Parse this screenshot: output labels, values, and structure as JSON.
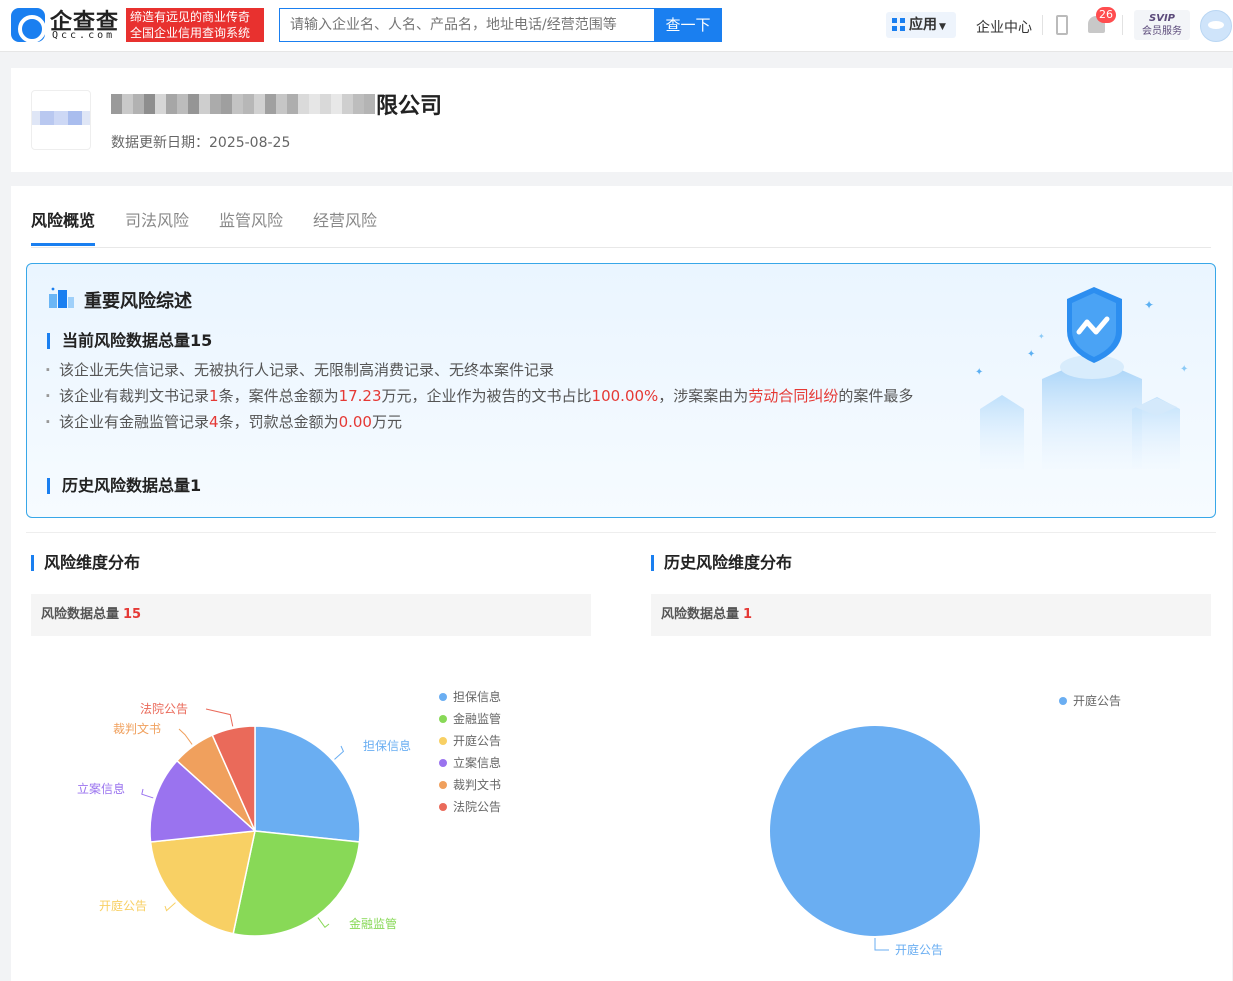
{
  "header": {
    "logo_cn": "企查查",
    "logo_en": "Qcc.com",
    "slogan_line1": "缔造有远见的商业传奇",
    "slogan_line2": "全国企业信用查询系统",
    "search_placeholder": "请输入企业名、人名、产品名，地址电话/经营范围等",
    "search_button": "查一下",
    "apps_label": "应用",
    "enterprise_center": "企业中心",
    "notification_count": "26",
    "svip_line1": "SVIP",
    "svip_line2": "会员服务"
  },
  "company": {
    "name_visible_suffix": "限公司",
    "update_date_label": "数据更新日期：",
    "update_date": "2025-08-25"
  },
  "tabs": [
    {
      "label": "风险概览",
      "active": true
    },
    {
      "label": "司法风险",
      "active": false
    },
    {
      "label": "监管风险",
      "active": false
    },
    {
      "label": "经营风险",
      "active": false
    }
  ],
  "summary": {
    "title": "重要风险综述",
    "current_heading": "当前风险数据总量15",
    "history_heading": "历史风险数据总量1",
    "line1": "该企业无失信记录、无被执行人记录、无限制高消费记录、无终本案件记录",
    "line2_a": "该企业有裁判文书记录",
    "line2_count": "1",
    "line2_b": "条，案件总金额为",
    "line2_amount": "17.23",
    "line2_c": "万元，企业作为被告的文书占比",
    "line2_pct": "100.00%",
    "line2_d": "，涉案案由为",
    "line2_cause": "劳动合同纠纷",
    "line2_e": "的案件最多",
    "line3_a": "该企业有金融监管记录",
    "line3_count": "4",
    "line3_b": "条，罚款总金额为",
    "line3_amount": "0.00",
    "line3_c": "万元"
  },
  "left_chart": {
    "heading": "风险维度分布",
    "total_label": "风险数据总量",
    "total": "15"
  },
  "right_chart": {
    "heading": "历史风险维度分布",
    "total_label": "风险数据总量",
    "total": "1"
  },
  "chart_data": [
    {
      "type": "pie",
      "title": "风险维度分布",
      "categories": [
        "担保信息",
        "金融监管",
        "开庭公告",
        "立案信息",
        "裁判文书",
        "法院公告"
      ],
      "values": [
        4,
        4,
        3,
        2,
        1,
        1
      ],
      "colors": [
        "#6aaef2",
        "#88d957",
        "#f8d064",
        "#9a73ef",
        "#f0a05d",
        "#ea6a5a"
      ],
      "legend": "right"
    },
    {
      "type": "pie",
      "title": "历史风险维度分布",
      "categories": [
        "开庭公告"
      ],
      "values": [
        1
      ],
      "colors": [
        "#6aaef2"
      ],
      "legend": "top-right"
    }
  ]
}
